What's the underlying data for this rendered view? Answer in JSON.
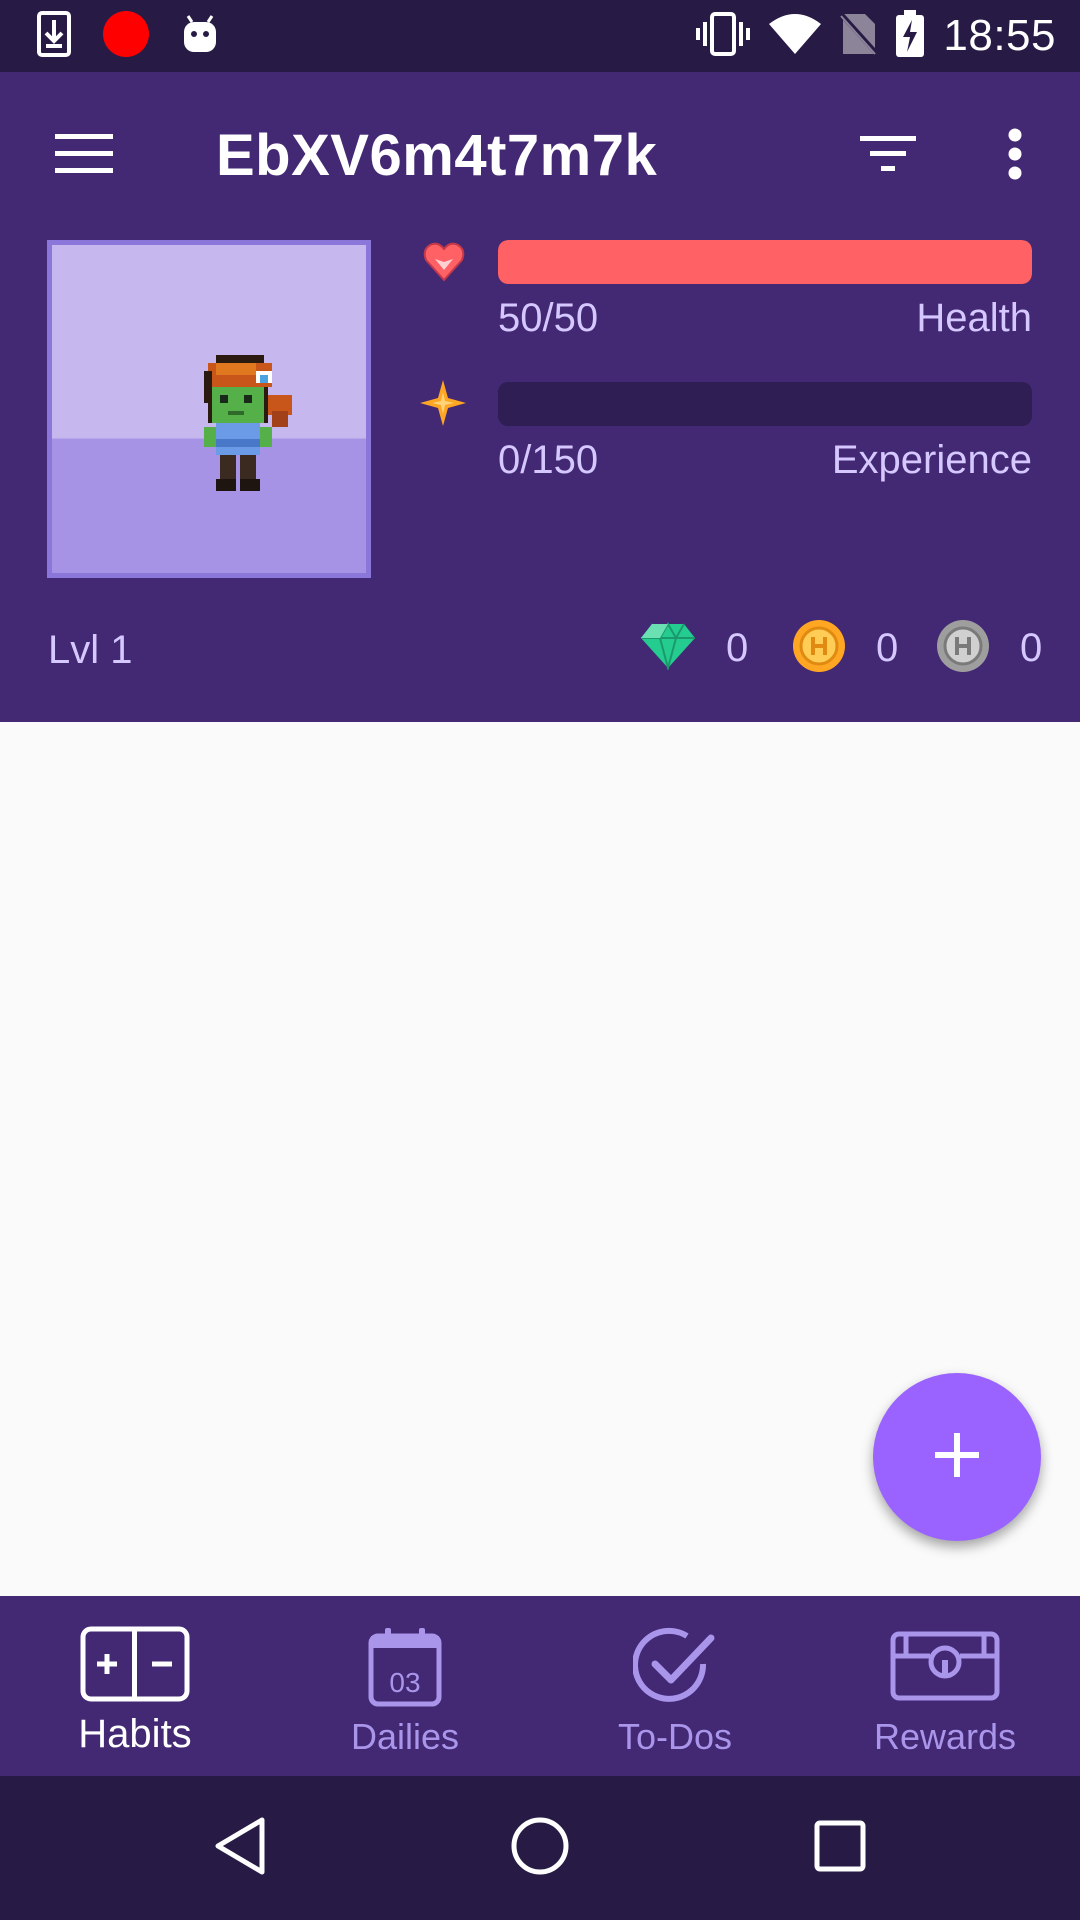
{
  "status_bar": {
    "time": "18:55",
    "icons": [
      "download-icon",
      "record-dot-icon",
      "android-icon",
      "vibrate-icon",
      "wifi-icon",
      "no-sim-icon",
      "battery-charging-icon"
    ]
  },
  "toolbar": {
    "title": "EbXV6m4t7m7k",
    "icons": [
      "menu-icon",
      "filter-icon",
      "more-vert-icon"
    ]
  },
  "stats": {
    "health": {
      "value_text": "50/50",
      "label": "Health",
      "fraction": 1.0,
      "color": "#ff6165",
      "icon": "heart-icon"
    },
    "experience": {
      "value_text": "0/150",
      "label": "Experience",
      "fraction": 0.0,
      "color": "#ffa623",
      "icon": "star-icon"
    }
  },
  "level": "Lvl 1",
  "currencies": {
    "gems": {
      "value": "0",
      "icon": "gem-icon",
      "color": "#24cc8f"
    },
    "gold": {
      "value": "0",
      "icon": "gold-coin-icon",
      "color": "#ffa623"
    },
    "hourglass": {
      "value": "0",
      "icon": "silver-coin-icon",
      "color": "#9e9e9e"
    }
  },
  "fab": {
    "icon": "plus-icon"
  },
  "bottom_nav": {
    "items": [
      {
        "label": "Habits",
        "icon": "habits-icon",
        "active": true
      },
      {
        "label": "Dailies",
        "icon": "calendar-icon",
        "calendar_day": "03",
        "active": false
      },
      {
        "label": "To-Dos",
        "icon": "check-circle-icon",
        "active": false
      },
      {
        "label": "Rewards",
        "icon": "treasure-chest-icon",
        "active": false
      }
    ]
  },
  "system_nav": {
    "icons": [
      "back-icon",
      "home-icon",
      "recents-icon"
    ]
  },
  "colors": {
    "header_bg": "#432874",
    "status_bg": "#271b45",
    "accent": "#9a62ff",
    "muted_text": "#d5c8ff"
  }
}
